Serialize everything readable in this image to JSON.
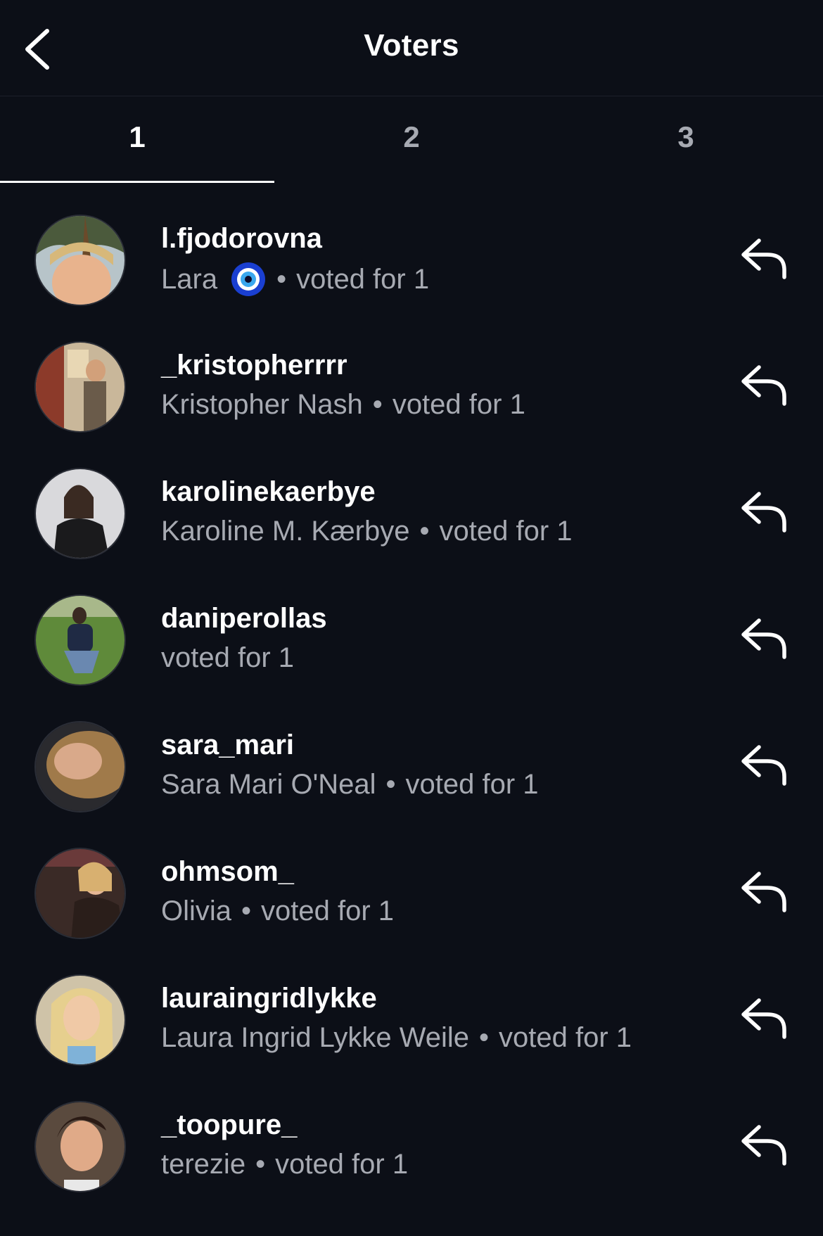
{
  "header": {
    "title": "Voters",
    "back_icon": "chevron-left-icon"
  },
  "tabs": [
    {
      "label": "1",
      "active": true
    },
    {
      "label": "2",
      "active": false
    },
    {
      "label": "3",
      "active": false
    }
  ],
  "separator": "•",
  "voters": [
    {
      "username": "l.fjodorovna",
      "full_name": "Lara",
      "emoji": "nazar-amulet-icon",
      "vote": "voted for 1"
    },
    {
      "username": "_kristopherrrr",
      "full_name": "Kristopher Nash",
      "vote": "voted for 1"
    },
    {
      "username": "karolinekaerbye",
      "full_name": "Karoline M. Kærbye",
      "vote": "voted for 1"
    },
    {
      "username": "daniperollas",
      "full_name": "",
      "vote": "voted for 1"
    },
    {
      "username": "sara_mari",
      "full_name": "Sara Mari O'Neal",
      "vote": "voted for 1"
    },
    {
      "username": "ohmsom_",
      "full_name": "Olivia",
      "vote": "voted for 1"
    },
    {
      "username": "lauraingridlykke",
      "full_name": "Laura Ingrid Lykke Weile",
      "vote": "voted for 1"
    },
    {
      "username": "_toopure_",
      "full_name": "terezie",
      "vote": "voted for 1"
    }
  ],
  "colors": {
    "background": "#0c0f17",
    "secondary_text": "#a7aab2",
    "primary_text": "#ffffff"
  }
}
